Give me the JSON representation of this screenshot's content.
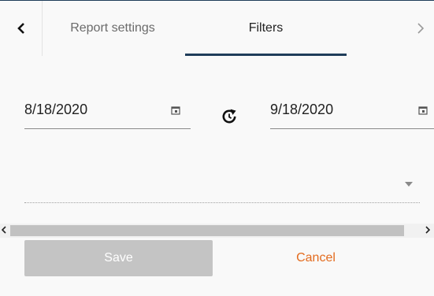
{
  "tabs": [
    {
      "label": "Report settings",
      "active": false
    },
    {
      "label": "Filters",
      "active": true
    }
  ],
  "filters": {
    "date_from": "8/18/2020",
    "date_to": "9/18/2020",
    "dropdown_value": ""
  },
  "actions": {
    "save_label": "Save",
    "save_enabled": false,
    "cancel_label": "Cancel"
  },
  "colors": {
    "accent": "#1f3d5a",
    "cancel": "#e36b1e",
    "save_disabled_bg": "#c4c4c4"
  },
  "icons": [
    "chevron-left-icon",
    "chevron-right-icon",
    "calendar-icon",
    "refresh-icon",
    "caret-down-icon"
  ]
}
